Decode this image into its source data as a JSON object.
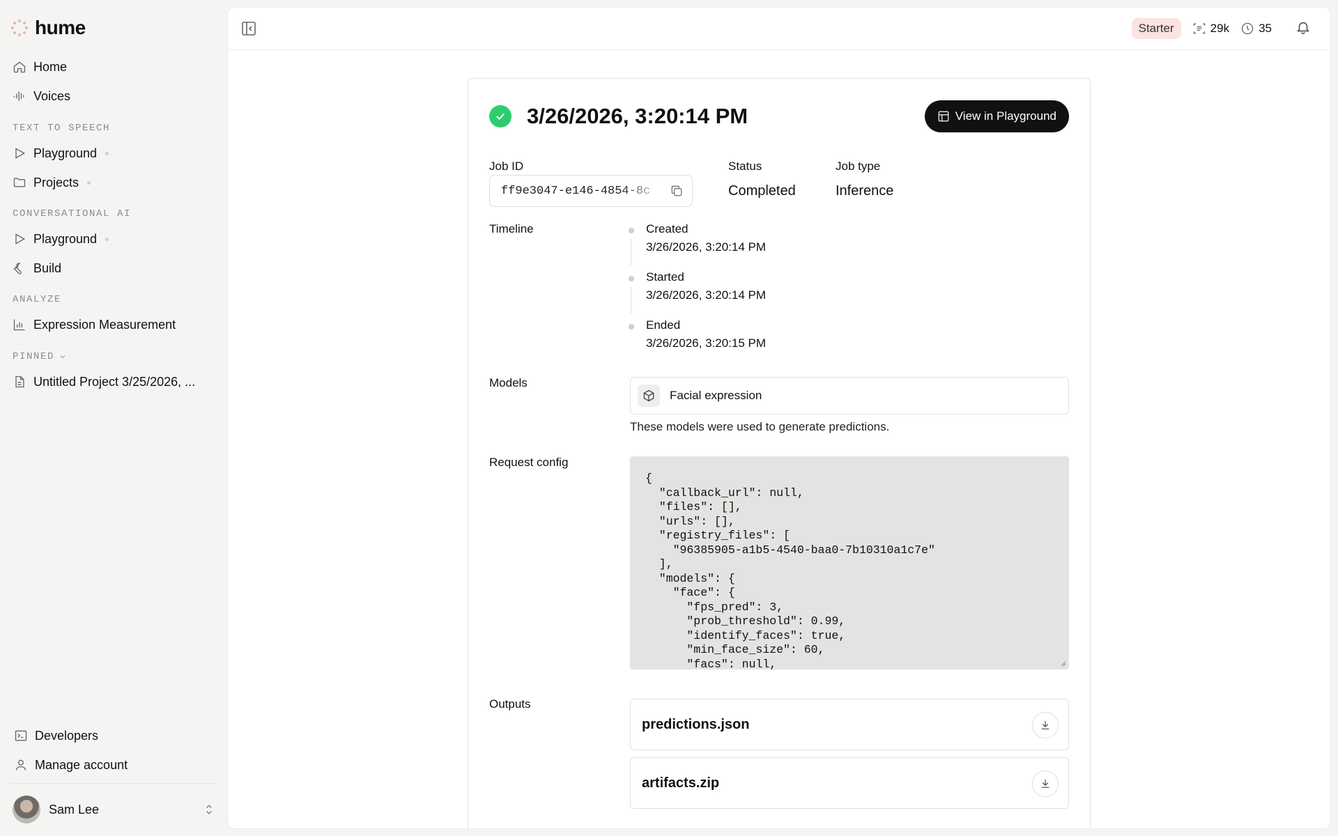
{
  "app": {
    "name": "hume"
  },
  "sidebar": {
    "top_items": [
      {
        "label": "Home",
        "icon": "home-icon"
      },
      {
        "label": "Voices",
        "icon": "waveform-icon"
      }
    ],
    "sections": [
      {
        "label": "TEXT TO SPEECH",
        "items": [
          {
            "label": "Playground",
            "icon": "play-icon"
          },
          {
            "label": "Projects",
            "icon": "folder-icon"
          }
        ]
      },
      {
        "label": "CONVERSATIONAL AI",
        "items": [
          {
            "label": "Playground",
            "icon": "play-icon"
          },
          {
            "label": "Build",
            "icon": "wrench-icon"
          }
        ]
      },
      {
        "label": "ANALYZE",
        "items": [
          {
            "label": "Expression Measurement",
            "icon": "bar-chart-icon"
          }
        ]
      },
      {
        "label": "PINNED",
        "items": [
          {
            "label": "Untitled Project 3/25/2026, ...",
            "icon": "document-icon"
          }
        ]
      }
    ],
    "bottom_items": [
      {
        "label": "Developers",
        "icon": "terminal-icon"
      },
      {
        "label": "Manage account",
        "icon": "user-icon"
      }
    ],
    "user": {
      "name": "Sam Lee"
    }
  },
  "topbar": {
    "plan": "Starter",
    "characters": "29k",
    "minutes": "35"
  },
  "job": {
    "title": "3/26/2026, 3:20:14 PM",
    "view_button": "View in Playground",
    "job_id_label": "Job ID",
    "job_id": "ff9e3047-e146-4854-8c",
    "status_label": "Status",
    "status": "Completed",
    "type_label": "Job type",
    "type": "Inference",
    "timeline_label": "Timeline",
    "timeline": [
      {
        "label": "Created",
        "time": "3/26/2026, 3:20:14 PM"
      },
      {
        "label": "Started",
        "time": "3/26/2026, 3:20:14 PM"
      },
      {
        "label": "Ended",
        "time": "3/26/2026, 3:20:15 PM"
      }
    ],
    "models_label": "Models",
    "model": "Facial expression",
    "models_note": "These models were used to generate predictions.",
    "config_label": "Request config",
    "config": "{\n  \"callback_url\": null,\n  \"files\": [],\n  \"urls\": [],\n  \"registry_files\": [\n    \"96385905-a1b5-4540-baa0-7b10310a1c7e\"\n  ],\n  \"models\": {\n    \"face\": {\n      \"fps_pred\": 3,\n      \"prob_threshold\": 0.99,\n      \"identify_faces\": true,\n      \"min_face_size\": 60,\n      \"facs\": null,",
    "outputs_label": "Outputs",
    "outputs": [
      "predictions.json",
      "artifacts.zip"
    ]
  },
  "colors": {
    "success": "#2ecc71",
    "plan_badge_bg": "#fbe3e1",
    "primary_button": "#111111"
  }
}
